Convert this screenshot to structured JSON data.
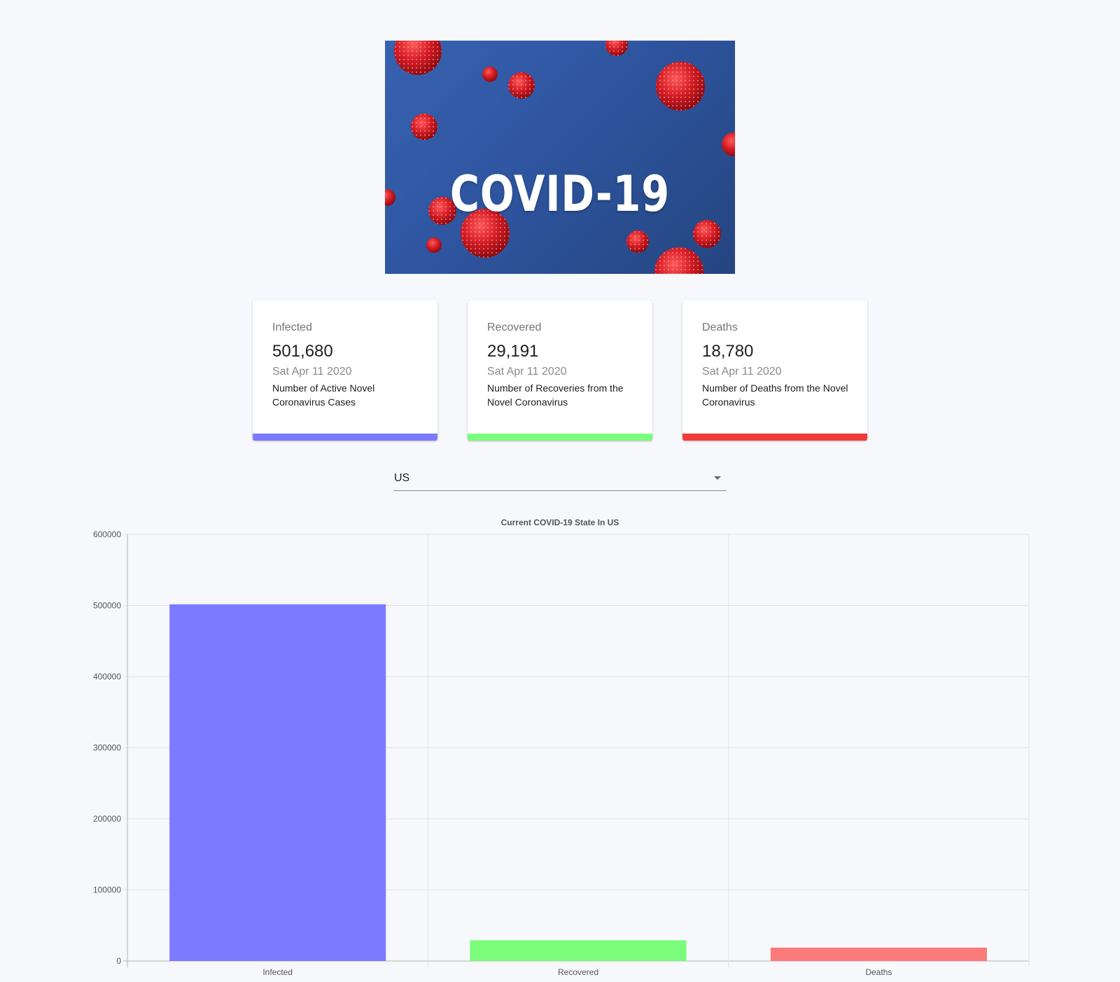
{
  "banner": {
    "title": "COVID-19"
  },
  "cards": [
    {
      "label": "Infected",
      "value": "501,680",
      "date": "Sat Apr 11 2020",
      "description": "Number of Active Novel Coronavirus Cases",
      "color": "#7b7bff"
    },
    {
      "label": "Recovered",
      "value": "29,191",
      "date": "Sat Apr 11 2020",
      "description": "Number of Recoveries from the Novel Coronavirus",
      "color": "#7bfc7b"
    },
    {
      "label": "Deaths",
      "value": "18,780",
      "date": "Sat Apr 11 2020",
      "description": "Number of Deaths from the Novel Coronavirus",
      "color": "#f23a3a"
    }
  ],
  "country_select": {
    "selected": "US",
    "icon": "chevron-down-icon"
  },
  "chart_data": {
    "type": "bar",
    "title": "Current COVID-19 State In US",
    "categories": [
      "Infected",
      "Recovered",
      "Deaths"
    ],
    "values": [
      501680,
      29191,
      18780
    ],
    "colors": [
      "#7b7bff",
      "#7bfc7b",
      "#fb7b7b"
    ],
    "ylim": [
      0,
      600000
    ],
    "yticks": [
      "0",
      "100000",
      "200000",
      "300000",
      "400000",
      "500000",
      "600000"
    ],
    "grid": true,
    "legend": "none"
  }
}
